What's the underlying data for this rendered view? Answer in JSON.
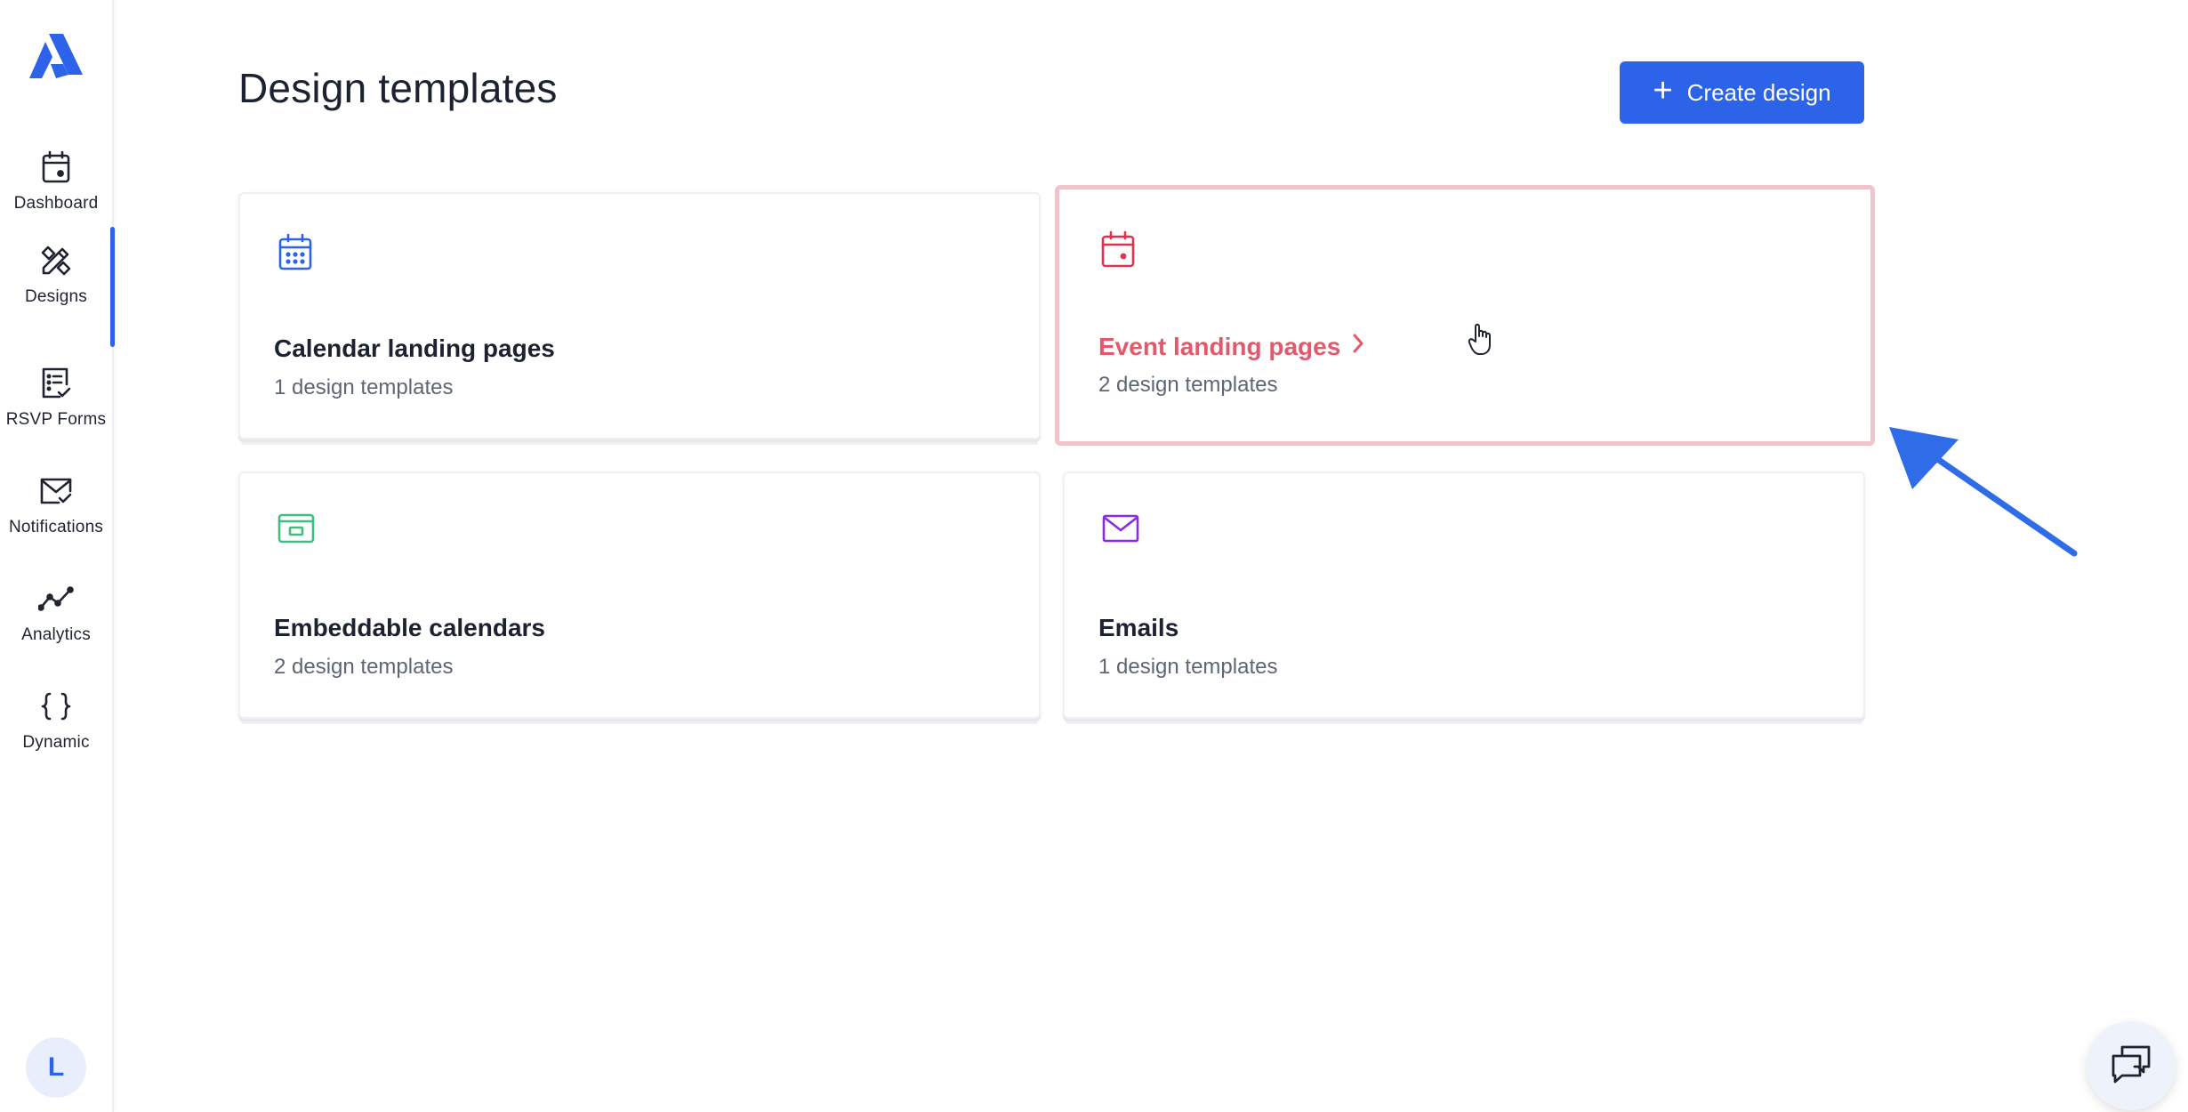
{
  "sidebar": {
    "logo": "logo-icon",
    "items": [
      {
        "label": "Dashboard",
        "icon": "calendar-dot-icon"
      },
      {
        "label": "Designs",
        "icon": "design-tools-icon"
      },
      {
        "label": "RSVP Forms",
        "icon": "form-check-icon"
      },
      {
        "label": "Notifications",
        "icon": "mail-check-icon"
      },
      {
        "label": "Analytics",
        "icon": "line-chart-icon"
      },
      {
        "label": "Dynamic",
        "icon": "braces-icon"
      }
    ],
    "active_item": "Designs",
    "avatar_initial": "L"
  },
  "header": {
    "title": "Design templates",
    "create_button": "Create design"
  },
  "cards": [
    {
      "title": "Calendar landing pages",
      "subtitle": "1 design templates",
      "icon": "calendar-grid-icon",
      "icon_color": "#2d63e8"
    },
    {
      "title": "Event landing pages",
      "subtitle": "2 design templates",
      "icon": "calendar-dot-icon",
      "icon_color": "#e0334f",
      "hovered": true
    },
    {
      "title": "Embeddable calendars",
      "subtitle": "2 design templates",
      "icon": "embed-window-icon",
      "icon_color": "#3fbf7f"
    },
    {
      "title": "Emails",
      "subtitle": "1 design templates",
      "icon": "mail-icon",
      "icon_color": "#8a2be2"
    }
  ],
  "colors": {
    "accent": "#2d63e8",
    "hover_title": "#e05a6c",
    "hover_border": "#f0c4cb",
    "annotation_arrow": "#2f6de8"
  },
  "chat": {
    "icon": "chat-bubbles-icon"
  }
}
